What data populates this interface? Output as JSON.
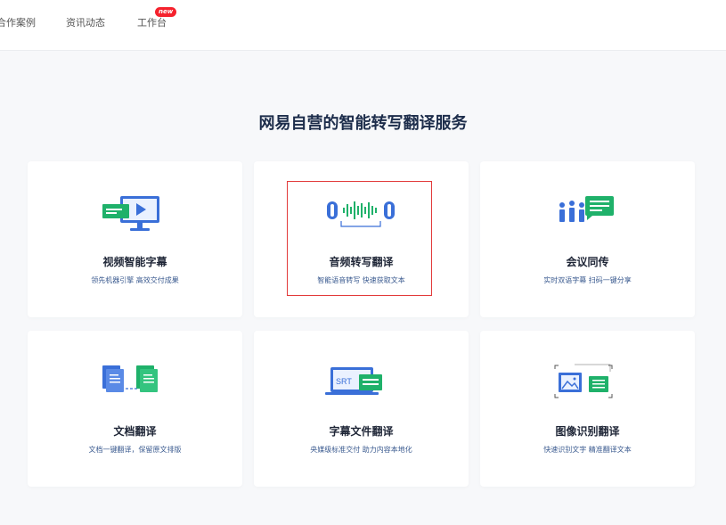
{
  "nav": {
    "items": [
      "合作案例",
      "资讯动态",
      "工作台"
    ],
    "badge": "new"
  },
  "main": {
    "title": "网易自营的智能转写翻译服务"
  },
  "cards": [
    {
      "title": "视频智能字幕",
      "desc": "领先机器引擎 高效交付成果",
      "icon": "video-monitor-icon"
    },
    {
      "title": "音频转写翻译",
      "desc": "智能语音转写 快速获取文本",
      "icon": "audio-waveform-icon"
    },
    {
      "title": "会议同传",
      "desc": "实时双语字幕 扫码一键分享",
      "icon": "meeting-interpret-icon"
    },
    {
      "title": "文档翻译",
      "desc": "文档一键翻译，保留原文排版",
      "icon": "document-translate-icon"
    },
    {
      "title": "字幕文件翻译",
      "desc": "央媒级标准交付 助力内容本地化",
      "icon": "srt-file-icon",
      "icon_text": "SRT"
    },
    {
      "title": "图像识别翻译",
      "desc": "快速识别文字 精准翻译文本",
      "icon": "image-recognition-icon"
    }
  ],
  "colors": {
    "blue": "#3a6fd8",
    "green": "#1fb16a",
    "title": "#1d2d4b",
    "highlight": "#e23a3a"
  }
}
